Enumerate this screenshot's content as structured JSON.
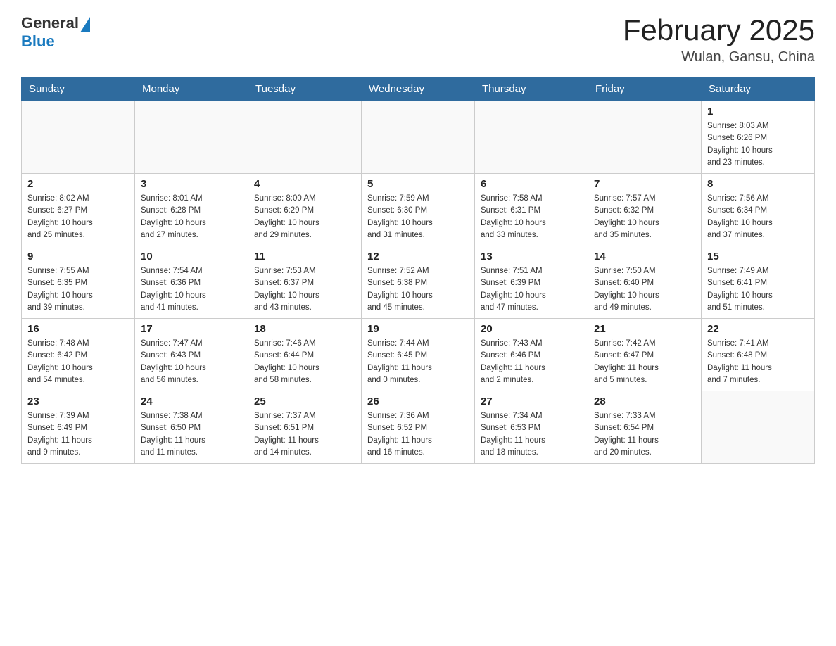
{
  "header": {
    "logo_general": "General",
    "logo_blue": "Blue",
    "title": "February 2025",
    "subtitle": "Wulan, Gansu, China"
  },
  "days_of_week": [
    "Sunday",
    "Monday",
    "Tuesday",
    "Wednesday",
    "Thursday",
    "Friday",
    "Saturday"
  ],
  "weeks": [
    [
      {
        "day": "",
        "info": ""
      },
      {
        "day": "",
        "info": ""
      },
      {
        "day": "",
        "info": ""
      },
      {
        "day": "",
        "info": ""
      },
      {
        "day": "",
        "info": ""
      },
      {
        "day": "",
        "info": ""
      },
      {
        "day": "1",
        "info": "Sunrise: 8:03 AM\nSunset: 6:26 PM\nDaylight: 10 hours\nand 23 minutes."
      }
    ],
    [
      {
        "day": "2",
        "info": "Sunrise: 8:02 AM\nSunset: 6:27 PM\nDaylight: 10 hours\nand 25 minutes."
      },
      {
        "day": "3",
        "info": "Sunrise: 8:01 AM\nSunset: 6:28 PM\nDaylight: 10 hours\nand 27 minutes."
      },
      {
        "day": "4",
        "info": "Sunrise: 8:00 AM\nSunset: 6:29 PM\nDaylight: 10 hours\nand 29 minutes."
      },
      {
        "day": "5",
        "info": "Sunrise: 7:59 AM\nSunset: 6:30 PM\nDaylight: 10 hours\nand 31 minutes."
      },
      {
        "day": "6",
        "info": "Sunrise: 7:58 AM\nSunset: 6:31 PM\nDaylight: 10 hours\nand 33 minutes."
      },
      {
        "day": "7",
        "info": "Sunrise: 7:57 AM\nSunset: 6:32 PM\nDaylight: 10 hours\nand 35 minutes."
      },
      {
        "day": "8",
        "info": "Sunrise: 7:56 AM\nSunset: 6:34 PM\nDaylight: 10 hours\nand 37 minutes."
      }
    ],
    [
      {
        "day": "9",
        "info": "Sunrise: 7:55 AM\nSunset: 6:35 PM\nDaylight: 10 hours\nand 39 minutes."
      },
      {
        "day": "10",
        "info": "Sunrise: 7:54 AM\nSunset: 6:36 PM\nDaylight: 10 hours\nand 41 minutes."
      },
      {
        "day": "11",
        "info": "Sunrise: 7:53 AM\nSunset: 6:37 PM\nDaylight: 10 hours\nand 43 minutes."
      },
      {
        "day": "12",
        "info": "Sunrise: 7:52 AM\nSunset: 6:38 PM\nDaylight: 10 hours\nand 45 minutes."
      },
      {
        "day": "13",
        "info": "Sunrise: 7:51 AM\nSunset: 6:39 PM\nDaylight: 10 hours\nand 47 minutes."
      },
      {
        "day": "14",
        "info": "Sunrise: 7:50 AM\nSunset: 6:40 PM\nDaylight: 10 hours\nand 49 minutes."
      },
      {
        "day": "15",
        "info": "Sunrise: 7:49 AM\nSunset: 6:41 PM\nDaylight: 10 hours\nand 51 minutes."
      }
    ],
    [
      {
        "day": "16",
        "info": "Sunrise: 7:48 AM\nSunset: 6:42 PM\nDaylight: 10 hours\nand 54 minutes."
      },
      {
        "day": "17",
        "info": "Sunrise: 7:47 AM\nSunset: 6:43 PM\nDaylight: 10 hours\nand 56 minutes."
      },
      {
        "day": "18",
        "info": "Sunrise: 7:46 AM\nSunset: 6:44 PM\nDaylight: 10 hours\nand 58 minutes."
      },
      {
        "day": "19",
        "info": "Sunrise: 7:44 AM\nSunset: 6:45 PM\nDaylight: 11 hours\nand 0 minutes."
      },
      {
        "day": "20",
        "info": "Sunrise: 7:43 AM\nSunset: 6:46 PM\nDaylight: 11 hours\nand 2 minutes."
      },
      {
        "day": "21",
        "info": "Sunrise: 7:42 AM\nSunset: 6:47 PM\nDaylight: 11 hours\nand 5 minutes."
      },
      {
        "day": "22",
        "info": "Sunrise: 7:41 AM\nSunset: 6:48 PM\nDaylight: 11 hours\nand 7 minutes."
      }
    ],
    [
      {
        "day": "23",
        "info": "Sunrise: 7:39 AM\nSunset: 6:49 PM\nDaylight: 11 hours\nand 9 minutes."
      },
      {
        "day": "24",
        "info": "Sunrise: 7:38 AM\nSunset: 6:50 PM\nDaylight: 11 hours\nand 11 minutes."
      },
      {
        "day": "25",
        "info": "Sunrise: 7:37 AM\nSunset: 6:51 PM\nDaylight: 11 hours\nand 14 minutes."
      },
      {
        "day": "26",
        "info": "Sunrise: 7:36 AM\nSunset: 6:52 PM\nDaylight: 11 hours\nand 16 minutes."
      },
      {
        "day": "27",
        "info": "Sunrise: 7:34 AM\nSunset: 6:53 PM\nDaylight: 11 hours\nand 18 minutes."
      },
      {
        "day": "28",
        "info": "Sunrise: 7:33 AM\nSunset: 6:54 PM\nDaylight: 11 hours\nand 20 minutes."
      },
      {
        "day": "",
        "info": ""
      }
    ]
  ]
}
